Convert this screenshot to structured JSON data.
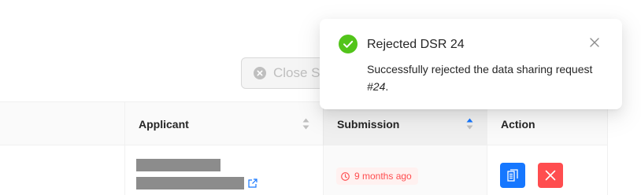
{
  "toolbar": {
    "close_selected_label": "Close Selected"
  },
  "table": {
    "headers": {
      "applicant": "Applicant",
      "submission": "Submission",
      "action": "Action"
    },
    "rows": [
      {
        "submission": "9 months ago"
      }
    ]
  },
  "notification": {
    "title": "Rejected DSR 24",
    "description_text": "Successfully rejected the data sharing request ",
    "description_ref": "#24",
    "description_end": "."
  },
  "colors": {
    "primary": "#1677ff",
    "danger": "#ff4d4f",
    "success": "#52c41a",
    "redacted": "#8c8c8c"
  },
  "icons": {
    "close_selected": "close-circle-icon",
    "sort": "sort-icon",
    "external_link": "external-link-icon",
    "time": "clock-icon",
    "view": "document-icon",
    "reject": "close-icon",
    "success": "check-circle-icon",
    "dismiss": "close-icon"
  }
}
